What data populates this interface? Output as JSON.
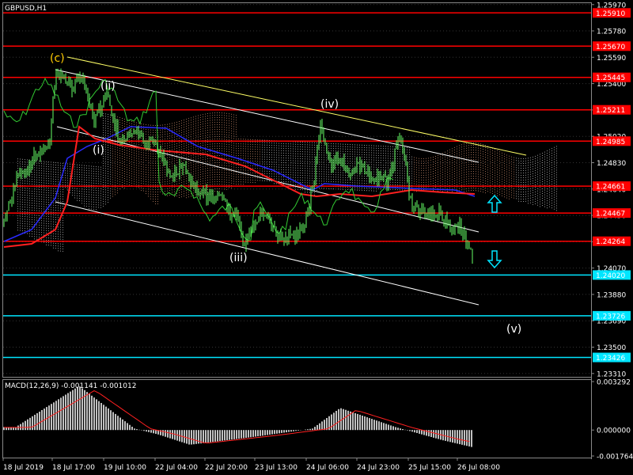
{
  "chart_data": [
    {
      "type": "line",
      "title": "GBPUSD,H1",
      "colors": {
        "background": "#000000",
        "price": "#66ff66",
        "tenkan": "#ff2020",
        "kijun": "#2a2aff",
        "chikou": "#33cc33",
        "cloud": "#c8c8c8",
        "cloud_bear": "#d09070",
        "resistance": "#ff0000",
        "support": "#00e5ff",
        "channel": "#ffffff",
        "trend": "#ffff66",
        "arrows": "#00e5ff",
        "wave_c": "#ffcc00",
        "wave_other": "#ffffff"
      },
      "ylim": [
        1.23286,
        1.2598
      ],
      "y_ticks": [
        "1.25970",
        "1.25780",
        "1.25590",
        "1.25400",
        "1.25210",
        "1.25020",
        "1.24830",
        "1.24640",
        "1.24450",
        "1.24260",
        "1.24070",
        "1.23880",
        "1.23690",
        "1.23500",
        "1.23310"
      ],
      "x_ticks": [
        "18 Jul 2019",
        "18 Jul 17:00",
        "19 Jul 10:00",
        "22 Jul 04:00",
        "22 Jul 20:00",
        "23 Jul 13:00",
        "24 Jul 06:00",
        "24 Jul 23:00",
        "25 Jul 15:00",
        "26 Jul 08:00"
      ],
      "levels": [
        {
          "value": 1.2591,
          "label": "1.25910",
          "kind": "resistance"
        },
        {
          "value": 1.2567,
          "label": "1.25670",
          "kind": "resistance"
        },
        {
          "value": 1.25445,
          "label": "1.25445",
          "kind": "resistance"
        },
        {
          "value": 1.25211,
          "label": "1.25211",
          "kind": "resistance"
        },
        {
          "value": 1.24985,
          "label": "1.24985",
          "kind": "resistance"
        },
        {
          "value": 1.24661,
          "label": "1.24661",
          "kind": "resistance"
        },
        {
          "value": 1.24467,
          "label": "1.24467",
          "kind": "resistance"
        },
        {
          "value": 1.24264,
          "label": "1.24264",
          "kind": "resistance"
        },
        {
          "value": 1.2402,
          "label": "1.24020",
          "kind": "support"
        },
        {
          "value": 1.23726,
          "label": "1.23726",
          "kind": "support"
        },
        {
          "value": 1.23426,
          "label": "1.23426",
          "kind": "support"
        }
      ],
      "wave_labels": [
        "(c)",
        "(ii)",
        "(i)",
        "(iii)",
        "(iv)",
        "(v)"
      ]
    },
    {
      "type": "bar",
      "title": "MACD(12,26,9) -0.001141 -0.001012",
      "ylim": [
        -0.001764,
        0.003292
      ],
      "y_ticks": [
        "0.003292",
        "0.000000",
        "-0.001764"
      ]
    }
  ]
}
